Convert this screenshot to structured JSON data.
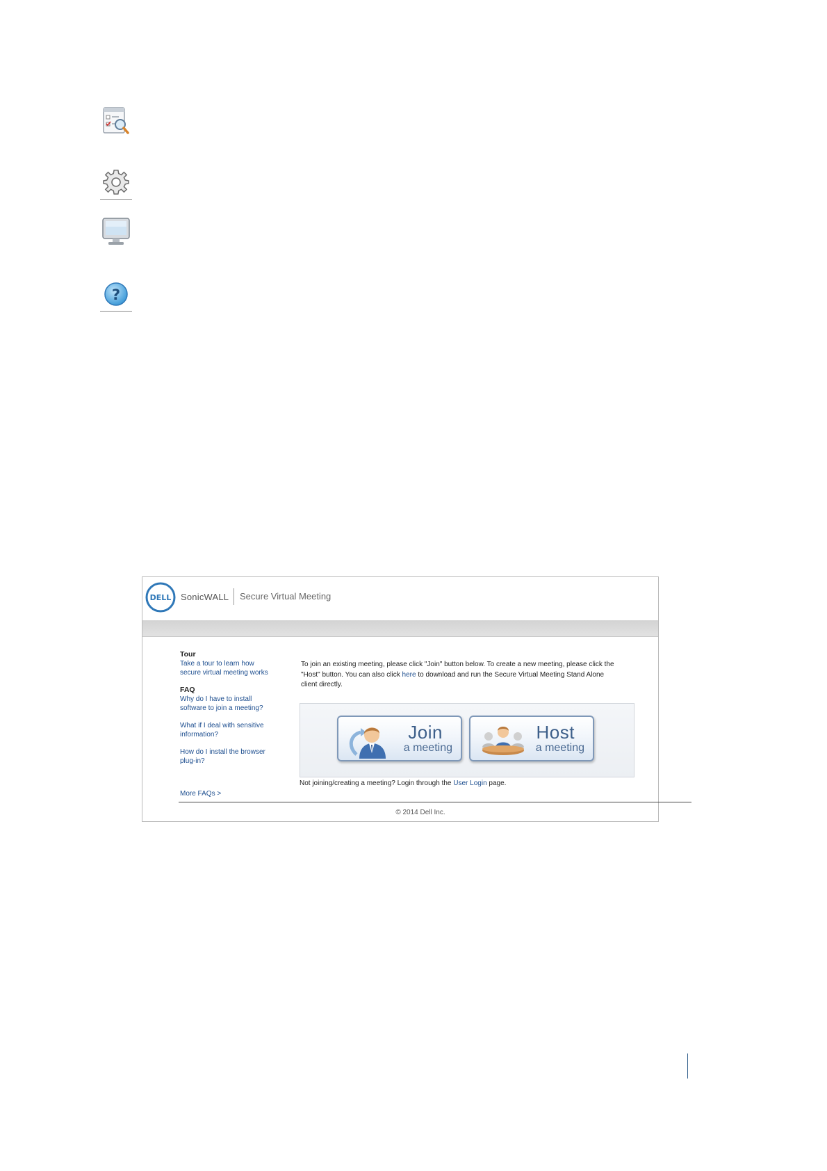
{
  "sidebar_icons": [
    "checklist-search-icon",
    "gear-icon",
    "monitor-icon",
    "help-icon"
  ],
  "header": {
    "logo_text": "DELL",
    "brand": "SonicWALL",
    "product": "Secure Virtual Meeting"
  },
  "left_panel": {
    "tour_title": "Tour",
    "tour_link_1": "Take a tour to learn how",
    "tour_link_2": "secure virtual meeting works",
    "faq_title": "FAQ",
    "faq_1a": "Why do I have to install",
    "faq_1b": "software to join a meeting?",
    "faq_2a": "What if I deal with sensitive",
    "faq_2b": "information?",
    "faq_3a": "How do I install the browser",
    "faq_3b": "plug-in?",
    "more": "More FAQs >"
  },
  "intro": {
    "line1": "To join an existing meeting, please click \"Join\" button below. To create a new meeting, please click the",
    "line2_a": "\"Host\" button. You can also click",
    "here": "here",
    "line2_b": "to download and run the Secure Virtual Meeting Stand Alone",
    "line3": "client directly."
  },
  "buttons": {
    "join_l1": "Join",
    "join_l2": "a meeting",
    "host_l1": "Host",
    "host_l2": "a meeting"
  },
  "notice": {
    "text_a": "Not joining/creating a meeting? Login through the",
    "link": "User Login",
    "text_b": "page."
  },
  "footer": {
    "copyright": "© 2014 Dell Inc."
  },
  "colors": {
    "link": "#1d4e8f",
    "accent": "#2f78b8"
  }
}
